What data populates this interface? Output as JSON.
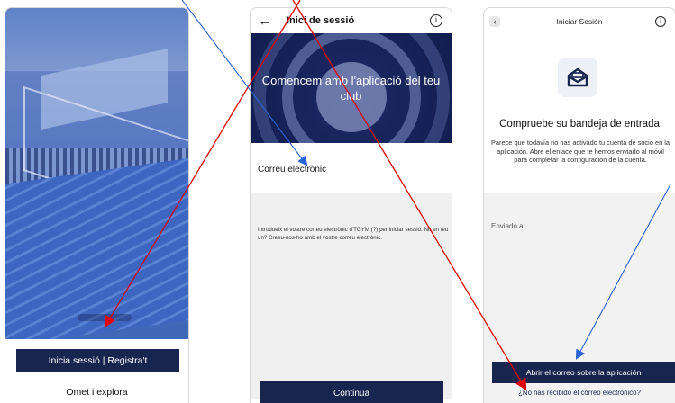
{
  "screen1": {
    "primary_button": "Inicia sessió | Registra't",
    "secondary_link": "Omet i explora"
  },
  "screen2": {
    "back_icon": "arrow-left-icon",
    "title": "Inici de sessió",
    "info_icon": "info-icon",
    "hero_text": "Comencem amb l'aplicació del teu club",
    "email_label": "Correu electrònic",
    "help_text": "Introdueix el vostre correu electrònic d'TGYM (?) per iniciar sessió. No en teu un? Creeu-nos-ho amb el vostre correu electrònic.",
    "continue_button": "Continua"
  },
  "screen3": {
    "back_icon": "chevron-left-icon",
    "title": "Iniciar Sesión",
    "info_icon": "info-icon",
    "mail_icon": "envelope-open-icon",
    "headline": "Compruebe su bandeja de entrada",
    "body": "Parece que todavía no has activado tu cuenta de socio en la aplicación. Abre el enlace que te hemos enviado al móvil para completar la configuración de la cuenta.",
    "sent_label": "Enviado a:",
    "open_mail_button": "Abrir el correo sobre la aplicación",
    "resend_link": "¿No has recibido el correo electrónico?"
  },
  "colors": {
    "primary": "#17254f",
    "hero_dark": "#0f1b4a",
    "annotation_red": "#e00000",
    "annotation_blue": "#2a63d6"
  }
}
